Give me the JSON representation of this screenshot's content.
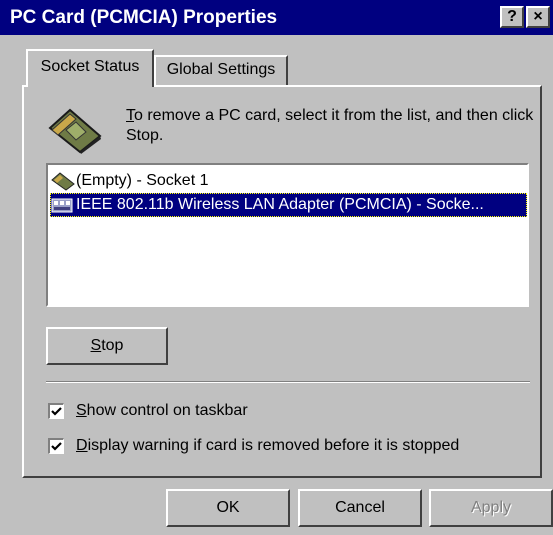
{
  "window": {
    "title": "PC Card (PCMCIA) Properties",
    "help_glyph": "?",
    "close_glyph": "×"
  },
  "tabs": [
    {
      "label": "Socket Status",
      "active": true
    },
    {
      "label": "Global Settings",
      "active": false
    }
  ],
  "instruction": {
    "mnemonic": "T",
    "rest": "o remove a PC card, select it from the list, and then click Stop."
  },
  "list": {
    "items": [
      {
        "label": "(Empty) - Socket 1",
        "icon": "pc-card-icon",
        "selected": false
      },
      {
        "label": "IEEE 802.11b Wireless LAN Adapter (PCMCIA) - Socke...",
        "icon": "network-card-icon",
        "selected": true
      }
    ]
  },
  "stop_button": {
    "mnemonic": "S",
    "rest": "top"
  },
  "options": [
    {
      "mnemonic": "S",
      "rest": "how control on taskbar",
      "checked": true
    },
    {
      "mnemonic": "D",
      "rest": "isplay warning if card is removed before it is stopped",
      "checked": true
    }
  ],
  "buttons": {
    "ok": "OK",
    "cancel": "Cancel",
    "apply": "Apply"
  },
  "colors": {
    "titlebar": "#000080",
    "face": "#c0c0c0",
    "selection": "#000080"
  }
}
